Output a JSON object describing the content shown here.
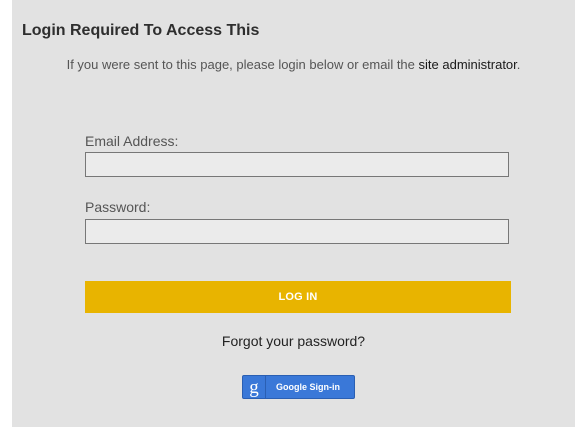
{
  "page": {
    "title": "Login Required To Access This",
    "intro_text": "If you were sent to this page, please login below or email the ",
    "admin_link": "site administrator",
    "intro_end": "."
  },
  "form": {
    "email_label": "Email Address:",
    "email_value": "",
    "password_label": "Password:",
    "password_value": "",
    "login_button": "LOG IN",
    "forgot_link": "Forgot your password?"
  },
  "google": {
    "icon_glyph": "g",
    "label": "Google Sign-in",
    "color": "#3a78d8"
  },
  "colors": {
    "panel_bg": "#e2e2e2",
    "login_button_bg": "#e8b400"
  }
}
